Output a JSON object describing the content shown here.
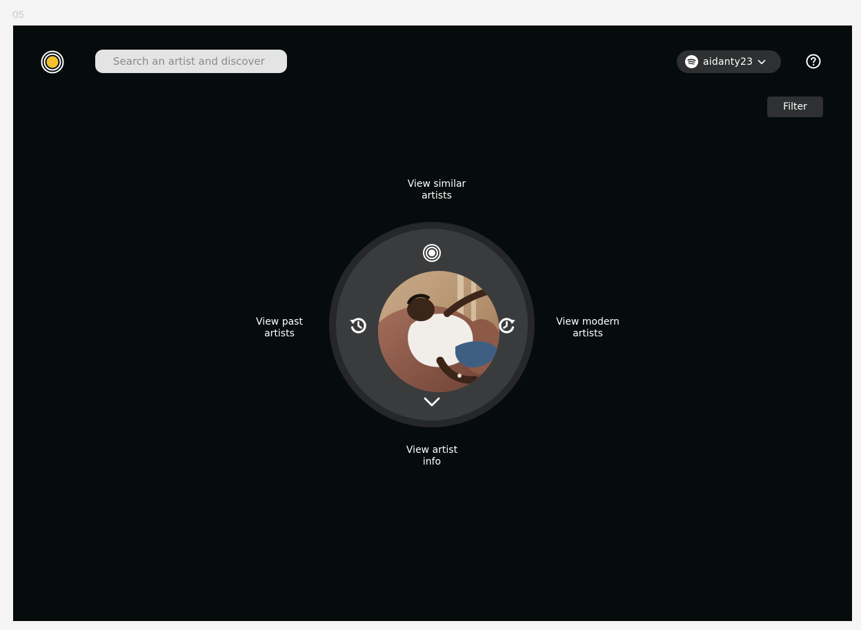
{
  "frame": {
    "label": "05"
  },
  "header": {
    "search_placeholder": "Search an artist and discover",
    "account": {
      "username": "aidanty23"
    },
    "filter_label": "Filter"
  },
  "wheel": {
    "similar": {
      "line1": "View similar",
      "line2": "artists"
    },
    "past": {
      "line1": "View past",
      "line2": "artists"
    },
    "modern": {
      "line1": "View modern",
      "line2": "artists"
    },
    "info": {
      "line1": "View artist",
      "line2": "info"
    }
  },
  "colors": {
    "canvas": "#060b0c",
    "accent": "#f2c12e",
    "control": "#2e3031",
    "wheel_outer": "#252728",
    "wheel_inner": "#3a3b3c"
  },
  "icons": {
    "logo": "radar-logo-icon",
    "spotify": "spotify-icon",
    "dropdown": "chevron-down-icon",
    "help": "help-circle-icon",
    "similar": "radar-icon",
    "past": "history-icon",
    "modern": "clock-forward-icon",
    "info": "chevron-down-icon"
  }
}
